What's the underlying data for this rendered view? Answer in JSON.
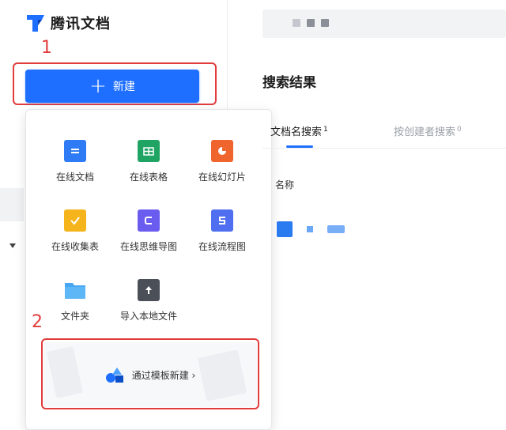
{
  "app": {
    "name": "腾讯文档",
    "accent": "#1e6fff",
    "annotation_color": "#e23c3c"
  },
  "sidebar": {
    "new_button_label": "新建",
    "new_button_icon": "plus-icon"
  },
  "annotations": {
    "step1": "1",
    "step2": "2"
  },
  "new_menu": {
    "items": [
      {
        "label": "在线文档",
        "icon": "doc-icon",
        "color": "#2f7bf6"
      },
      {
        "label": "在线表格",
        "icon": "sheet-icon",
        "color": "#1fa463"
      },
      {
        "label": "在线幻灯片",
        "icon": "slides-icon",
        "color": "#f0642d"
      },
      {
        "label": "在线收集表",
        "icon": "form-icon",
        "color": "#f5b41c"
      },
      {
        "label": "在线思维导图",
        "icon": "mindmap-icon",
        "color": "#6b5cf0"
      },
      {
        "label": "在线流程图",
        "icon": "flowchart-icon",
        "color": "#4f6ff0"
      },
      {
        "label": "文件夹",
        "icon": "folder-icon",
        "color": "#48a7f2"
      },
      {
        "label": "导入本地文件",
        "icon": "upload-icon",
        "color": "#4a4f58"
      }
    ],
    "template_label": "通过模板新建 ›",
    "template_icon": "template-shapes-icon"
  },
  "search": {
    "title": "搜索结果",
    "tabs": [
      {
        "label": "文档名搜索",
        "count": "1",
        "active": true
      },
      {
        "label": "按创建者搜索",
        "count": "0",
        "active": false
      }
    ],
    "column_header": "名称"
  }
}
